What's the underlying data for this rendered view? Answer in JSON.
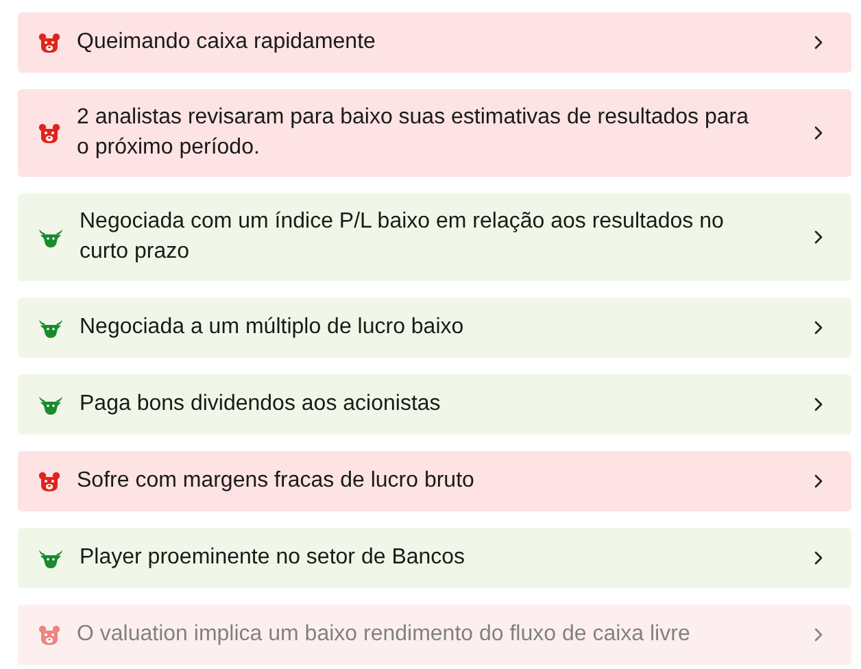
{
  "items": [
    {
      "kind": "bear",
      "text": "Queimando caixa rapidamente",
      "faded": false
    },
    {
      "kind": "bear",
      "text": "2 analistas revisaram para baixo suas estimativas de resultados para o próximo período.",
      "faded": false
    },
    {
      "kind": "bull",
      "text": "Negociada com um índice P/L baixo em relação aos resultados no curto prazo",
      "faded": false
    },
    {
      "kind": "bull",
      "text": "Negociada a um múltiplo de lucro baixo",
      "faded": false
    },
    {
      "kind": "bull",
      "text": "Paga bons dividendos aos acionistas",
      "faded": false
    },
    {
      "kind": "bear",
      "text": "Sofre com margens fracas de lucro bruto",
      "faded": false
    },
    {
      "kind": "bull",
      "text": "Player proeminente no setor de Bancos",
      "faded": false
    },
    {
      "kind": "bear",
      "text": "O valuation implica um baixo rendimento do fluxo de caixa livre",
      "faded": true
    }
  ]
}
